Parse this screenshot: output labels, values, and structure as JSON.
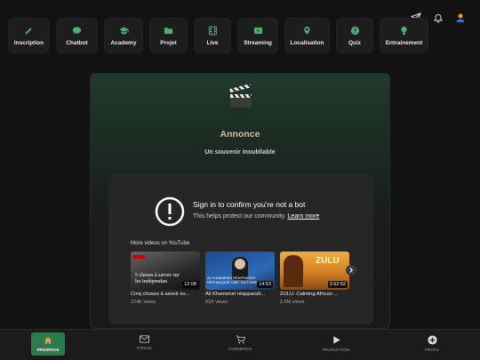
{
  "top_icons": [
    "send-icon",
    "bell-icon",
    "user-avatar-icon"
  ],
  "nav": [
    {
      "label": "Inscription",
      "icon": "pencil-icon"
    },
    {
      "label": "Chatbot",
      "icon": "chat-icon"
    },
    {
      "label": "Academy",
      "icon": "graduation-cap-icon"
    },
    {
      "label": "Projet",
      "icon": "folder-icon"
    },
    {
      "label": "Live",
      "icon": "film-icon"
    },
    {
      "label": "Streaming",
      "icon": "video-icon"
    },
    {
      "label": "Localisation",
      "icon": "map-pin-icon"
    },
    {
      "label": "Quiz",
      "icon": "question-icon"
    },
    {
      "label": "Entrainement",
      "icon": "trophy-icon"
    }
  ],
  "card": {
    "icon": "clapperboard-icon",
    "title": "Annonce",
    "subtitle": "Un souvenir inoubliable"
  },
  "youtube": {
    "title": "Sign in to confirm you're not a bot",
    "desc": "This helps protect our community.",
    "learn_more": "Learn more",
    "more_videos": "More videos on YouTube",
    "videos": [
      {
        "caption": "Cinq choses à savoir su...",
        "views": "124K views",
        "duration": "12:08",
        "overlay": "5 choses à savoir sur les indépendan"
      },
      {
        "caption": "Ali Khamenei réapparaît...",
        "views": "51K views",
        "duration": "14:53",
        "overlay": "ALI KHAMENEI RÉAPPARAÎT: RÉPUBLIQUE UNE \"VICTOIRE\""
      },
      {
        "caption": "ZULU: Calming African ...",
        "views": "2.5M views",
        "duration": "3:52:52",
        "overlay": "ZULU"
      }
    ]
  },
  "bottom_nav": [
    {
      "label": "PROSPACE",
      "icon": "home-icon",
      "active": true
    },
    {
      "label": "FORUM",
      "icon": "mail-icon",
      "active": false
    },
    {
      "label": "COMMERCE",
      "icon": "cart-icon",
      "active": false
    },
    {
      "label": "PRODUCTION",
      "icon": "play-icon",
      "active": false
    },
    {
      "label": "PROFIL",
      "icon": "plus-circle-icon",
      "active": false
    }
  ]
}
